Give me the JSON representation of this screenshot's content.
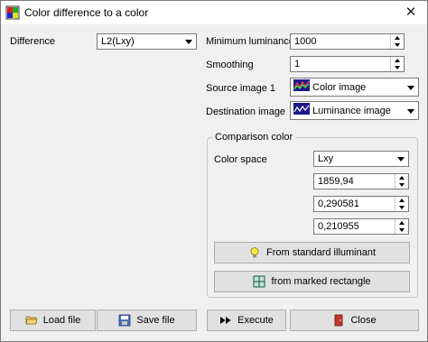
{
  "window": {
    "title": "Color difference to a color",
    "close_glyph": "✕"
  },
  "difference": {
    "label": "Difference",
    "value": "L2(Lxy)"
  },
  "min_luminance": {
    "label": "Minimum luminance",
    "value": "1000"
  },
  "smoothing": {
    "label": "Smoothing",
    "value": "1"
  },
  "source_image": {
    "label": "Source image 1",
    "value": "Color image",
    "icon": "color-image-icon"
  },
  "destination_image": {
    "label": "Destination image",
    "value": "Luminance image",
    "icon": "luminance-image-icon"
  },
  "comparison": {
    "title": "Comparison color",
    "color_space_label": "Color space",
    "color_space_value": "Lxy",
    "values": [
      "1859,94",
      "0,290581",
      "0,210955"
    ],
    "from_illuminant_label": "From standard illuminant",
    "from_rectangle_label": "from marked rectangle"
  },
  "footer": {
    "load_label": "Load file",
    "save_label": "Save file",
    "execute_label": "Execute",
    "close_label": "Close"
  }
}
